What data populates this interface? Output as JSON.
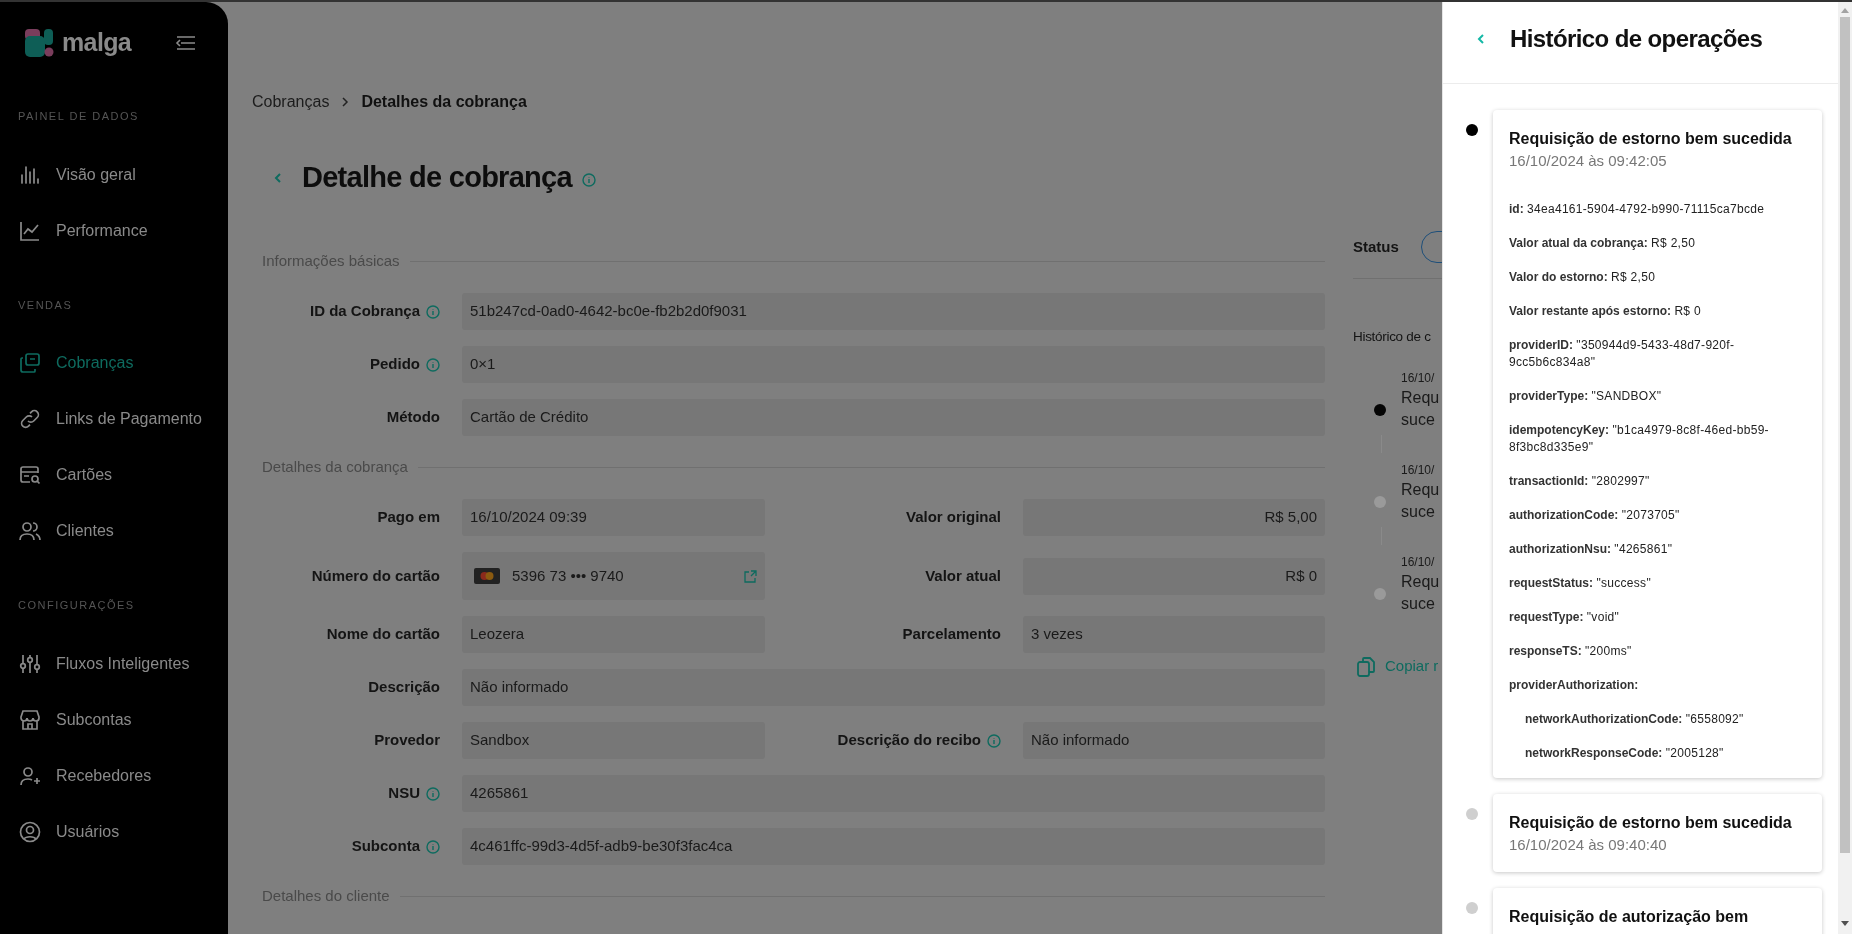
{
  "sidebar": {
    "brand": "malga",
    "sections": [
      {
        "heading": "PAINEL DE DADOS",
        "items": [
          {
            "label": "Visão geral",
            "selected": false
          },
          {
            "label": "Performance",
            "selected": false
          }
        ]
      },
      {
        "heading": "VENDAS",
        "items": [
          {
            "label": "Cobranças",
            "selected": true
          },
          {
            "label": "Links de Pagamento",
            "selected": false
          },
          {
            "label": "Cartões",
            "selected": false
          },
          {
            "label": "Clientes",
            "selected": false
          }
        ]
      },
      {
        "heading": "CONFIGURAÇÕES",
        "items": [
          {
            "label": "Fluxos Inteligentes",
            "selected": false
          },
          {
            "label": "Subcontas",
            "selected": false
          },
          {
            "label": "Recebedores",
            "selected": false
          },
          {
            "label": "Usuários",
            "selected": false
          }
        ]
      }
    ]
  },
  "breadcrumb": [
    {
      "label": "Cobranças",
      "current": false
    },
    {
      "label": "Detalhes da cobrança",
      "current": true
    }
  ],
  "page_title": "Detalhe de cobrança",
  "sections": [
    {
      "title": "Informações básicas",
      "rows": [
        [
          {
            "kind": "text",
            "label": "ID da Cobrança",
            "info": true,
            "value": "51b247cd-0ad0-4642-bc0e-fb2b2d0f9031"
          }
        ],
        [
          {
            "kind": "text",
            "label": "Pedido",
            "info": true,
            "value": "0×1"
          }
        ],
        [
          {
            "kind": "text",
            "label": "Método",
            "info": false,
            "value": "Cartão de Crédito"
          }
        ]
      ]
    },
    {
      "title": "Detalhes da cobrança",
      "rows": [
        [
          {
            "kind": "text",
            "label": "Pago em",
            "info": false,
            "value": "16/10/2024 09:39"
          },
          {
            "kind": "money",
            "label": "Valor original",
            "info": false,
            "value": "R$ 5,00"
          }
        ],
        [
          {
            "kind": "card",
            "label": "Número do cartão",
            "info": false,
            "value": "5396 73 ••• 9740"
          },
          {
            "kind": "money",
            "label": "Valor atual",
            "info": false,
            "value": "R$ 0"
          }
        ],
        [
          {
            "kind": "text",
            "label": "Nome do cartão",
            "info": false,
            "value": "Leozera"
          },
          {
            "kind": "text",
            "label": "Parcelamento",
            "info": false,
            "value": "3 vezes"
          }
        ],
        [
          {
            "kind": "text",
            "label": "Descrição",
            "info": false,
            "value": "Não informado"
          }
        ],
        [
          {
            "kind": "text",
            "label": "Provedor",
            "info": false,
            "value": "Sandbox"
          },
          {
            "kind": "text",
            "label": "Descrição do recibo",
            "info": true,
            "value": "Não informado"
          }
        ],
        [
          {
            "kind": "text",
            "label": "NSU",
            "info": true,
            "value": "4265861"
          }
        ],
        [
          {
            "kind": "text",
            "label": "Subconta",
            "info": true,
            "value": "4c461ffc-99d3-4d5f-adb9-be30f3fac4ca"
          }
        ]
      ]
    },
    {
      "title": "Detalhes do cliente"
    }
  ],
  "status": {
    "label": "Status"
  },
  "history": {
    "title": "Histórico de c",
    "items": [
      {
        "date": "16/10/",
        "title_lines": [
          "Requ",
          "suce"
        ],
        "current": true
      },
      {
        "date": "16/10/",
        "title_lines": [
          "Requ",
          "suce"
        ],
        "current": false
      },
      {
        "date": "16/10/",
        "title_lines": [
          "Requ",
          "suce"
        ],
        "current": false
      }
    ],
    "copy_link": "Copiar r"
  },
  "drawer": {
    "title": "Histórico de operações",
    "events": [
      {
        "title": "Requisição de estorno bem sucedida",
        "time": "16/10/2024 às 09:42:05",
        "current": true,
        "details": [
          {
            "key": "id:",
            "value": "34ea4161-5904-4792-b990-71115ca7bcde"
          },
          {
            "key": "Valor atual da cobrança:",
            "value": "R$ 2,50"
          },
          {
            "key": "Valor do estorno:",
            "value": "R$ 2,50"
          },
          {
            "key": "Valor restante após estorno:",
            "value": "R$ 0"
          },
          {
            "key": "providerID:",
            "value": "\"350944d9-5433-48d7-920f-9cc5b6c834a8\""
          },
          {
            "key": "providerType:",
            "value": "\"SANDBOX\""
          },
          {
            "key": "idempotencyKey:",
            "value": "\"b1ca4979-8c8f-46ed-bb59-8f3bc8d335e9\""
          },
          {
            "key": "transactionId:",
            "value": "\"2802997\""
          },
          {
            "key": "authorizationCode:",
            "value": "\"2073705\""
          },
          {
            "key": "authorizationNsu:",
            "value": "\"4265861\""
          },
          {
            "key": "requestStatus:",
            "value": "\"success\""
          },
          {
            "key": "requestType:",
            "value": "\"void\""
          },
          {
            "key": "responseTS:",
            "value": "\"200ms\""
          },
          {
            "key": "providerAuthorization:",
            "children": [
              {
                "key": "networkAuthorizationCode:",
                "value": "\"6558092\""
              },
              {
                "key": "networkResponseCode:",
                "value": "\"2005128\""
              }
            ]
          }
        ]
      },
      {
        "title": "Requisição de estorno bem sucedida",
        "time": "16/10/2024 às 09:40:40",
        "current": false
      },
      {
        "title": "Requisição de autorização bem",
        "current": false
      }
    ]
  }
}
